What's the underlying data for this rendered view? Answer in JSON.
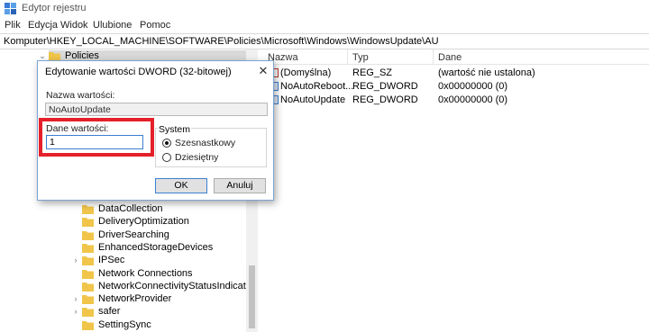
{
  "window": {
    "title": "Edytor rejestru",
    "app_icon": "registry-editor-icon"
  },
  "menu": [
    "Plik",
    "Edycja",
    "Widok",
    "Ulubione",
    "Pomoc"
  ],
  "address": {
    "path": "Komputer\\HKEY_LOCAL_MACHINE\\SOFTWARE\\Policies\\Microsoft\\Windows\\WindowsUpdate\\AU"
  },
  "tree": {
    "top_item": "Policies",
    "items": [
      {
        "label": "DataCollection",
        "expandable": false
      },
      {
        "label": "DeliveryOptimization",
        "expandable": false
      },
      {
        "label": "DriverSearching",
        "expandable": false
      },
      {
        "label": "EnhancedStorageDevices",
        "expandable": false
      },
      {
        "label": "IPSec",
        "expandable": true
      },
      {
        "label": "Network Connections",
        "expandable": false
      },
      {
        "label": "NetworkConnectivityStatusIndicator",
        "expandable": false
      },
      {
        "label": "NetworkProvider",
        "expandable": true
      },
      {
        "label": "safer",
        "expandable": true
      },
      {
        "label": "SettingSync",
        "expandable": false
      }
    ]
  },
  "list": {
    "headers": [
      "Nazwa",
      "Typ",
      "Dane"
    ],
    "rows": [
      {
        "name": "(Domyślna)",
        "type": "REG_SZ",
        "data": "(wartość nie ustalona)"
      },
      {
        "name": "NoAutoReboot...",
        "type": "REG_DWORD",
        "data": "0x00000000 (0)"
      },
      {
        "name": "NoAutoUpdate",
        "type": "REG_DWORD",
        "data": "0x00000000 (0)"
      }
    ]
  },
  "dialog": {
    "title": "Edytowanie wartości DWORD (32-bitowej)",
    "close_glyph": "✕",
    "name_label": "Nazwa wartości:",
    "name_value": "NoAutoUpdate",
    "data_label": "Dane wartości:",
    "data_value": "1",
    "base_label": "System",
    "base_options": [
      "Szesnastkowy",
      "Dziesiętny"
    ],
    "base_selected": "Szesnastkowy",
    "ok_label": "OK",
    "cancel_label": "Anuluj",
    "highlight_color": "#e4202a"
  },
  "colors": {
    "accent": "#3c7fd1",
    "folder": "#f0c54a"
  }
}
